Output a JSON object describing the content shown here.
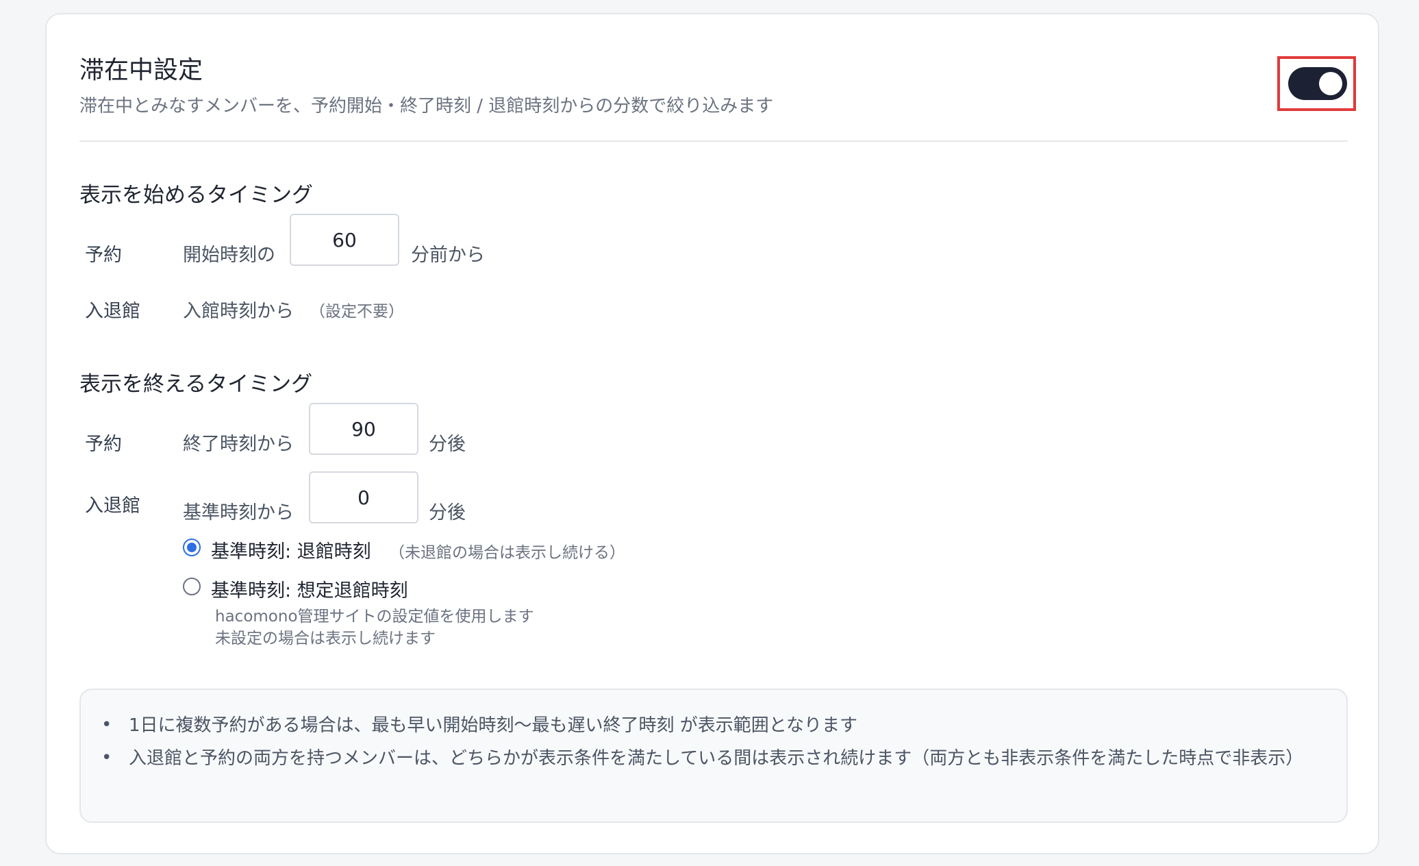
{
  "header": {
    "title": "滞在中設定",
    "subtitle": "滞在中とみなすメンバーを、予約開始・終了時刻 / 退館時刻からの分数で絞り込みます",
    "toggle_on": true
  },
  "start_section": {
    "heading": "表示を始めるタイミング",
    "reservation": {
      "label": "予約",
      "prefix": "開始時刻の",
      "value": "60",
      "suffix": "分前から"
    },
    "entry_exit": {
      "label": "入退館",
      "prefix": "入館時刻から",
      "note": "（設定不要）"
    }
  },
  "end_section": {
    "heading": "表示を終えるタイミング",
    "reservation": {
      "label": "予約",
      "prefix": "終了時刻から",
      "value": "90",
      "suffix": "分後"
    },
    "entry_exit": {
      "label": "入退館",
      "prefix": "基準時刻から",
      "value": "0",
      "suffix": "分後"
    },
    "radio_options": [
      {
        "label": "基準時刻: 退館時刻",
        "note": "（未退館の場合は表示し続ける）",
        "checked": true
      },
      {
        "label": "基準時刻: 想定退館時刻",
        "desc_line1": "hacomono管理サイトの設定値を使用します",
        "desc_line2": "未設定の場合は表示し続けます",
        "checked": false
      }
    ]
  },
  "info_box": {
    "bullet_symbol": "•",
    "items": [
      "1日に複数予約がある場合は、最も早い開始時刻〜最も遅い終了時刻 が表示範囲となります",
      "入退館と予約の両方を持つメンバーは、どちらかが表示条件を満たしている間は表示され続けます（両方とも非表示条件を満たした時点で非表示）"
    ]
  },
  "colors": {
    "toggle_on": "#1c2233",
    "highlight_frame": "#e03a3a",
    "radio_accent": "#2f6fe4"
  }
}
